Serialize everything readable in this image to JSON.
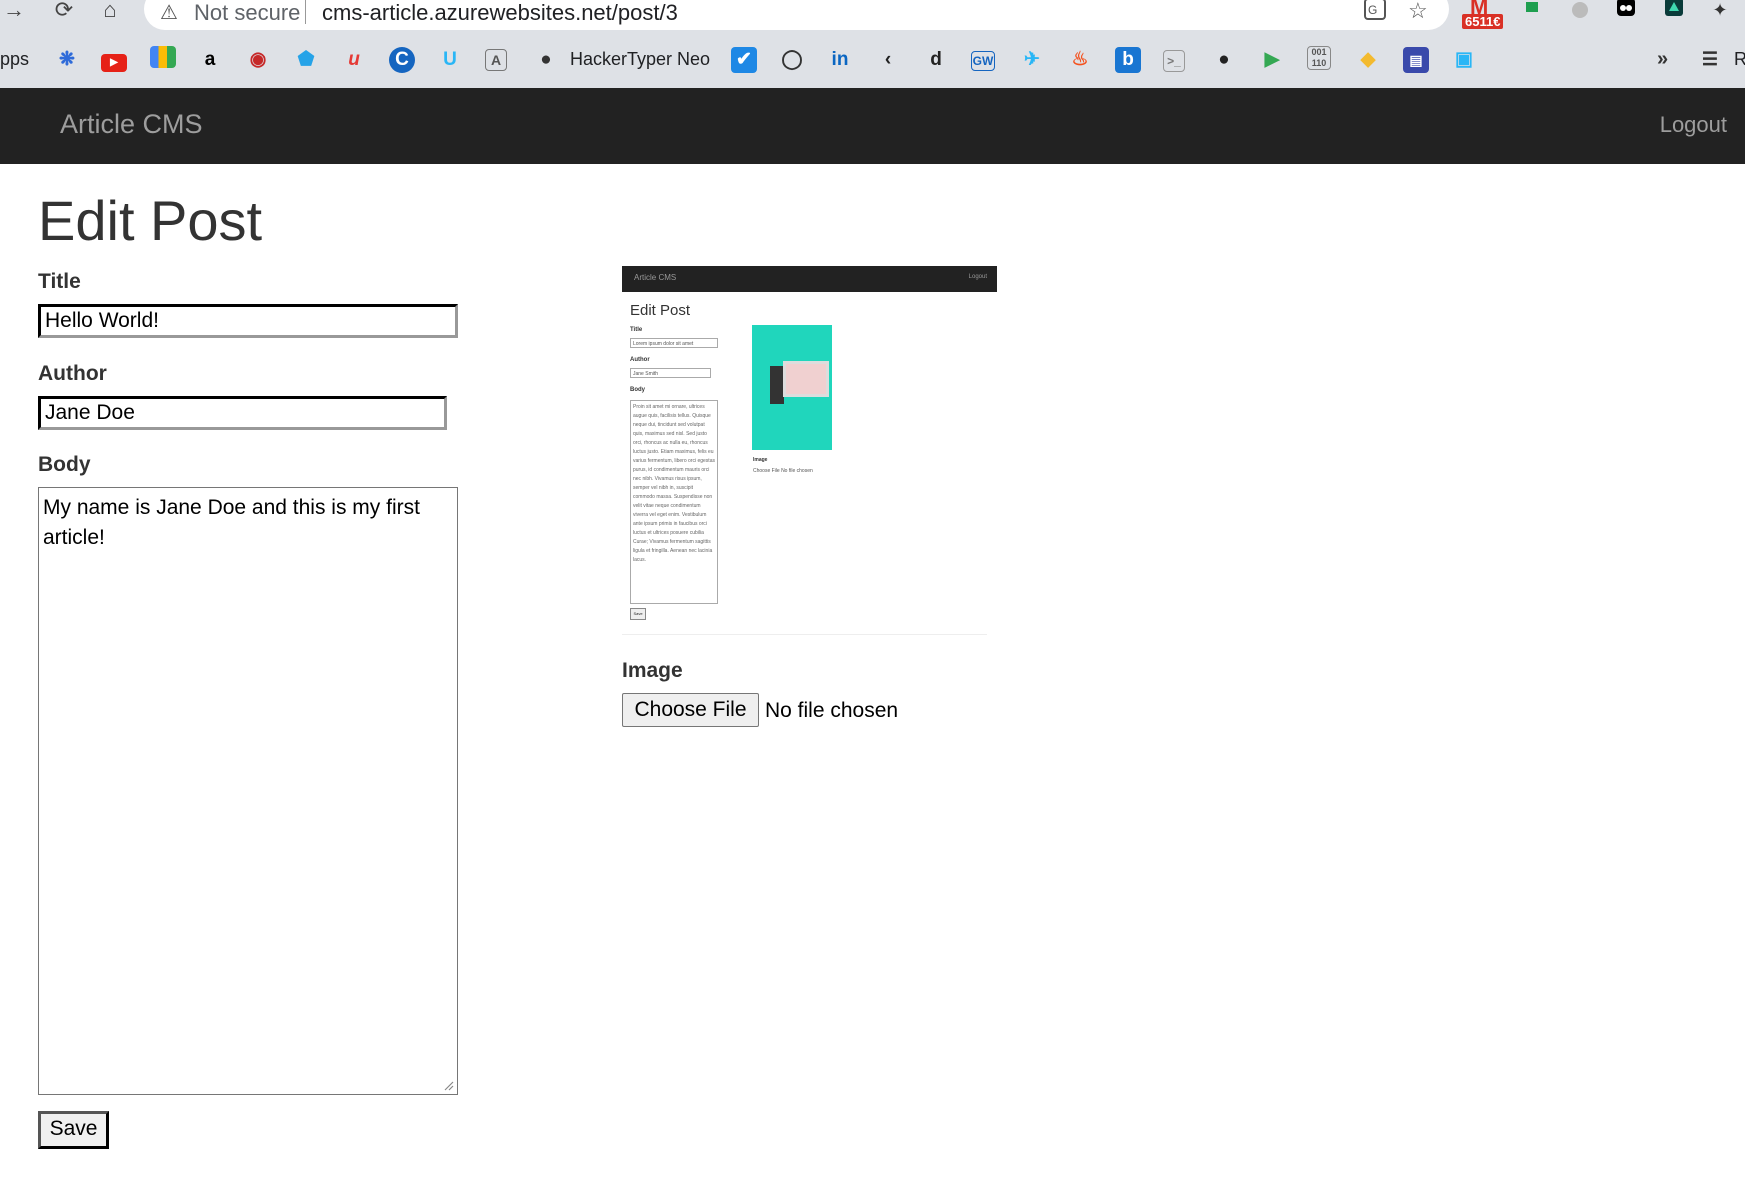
{
  "browser": {
    "nav": {
      "back_icon": "→",
      "reload_icon": "⟳",
      "home_icon": "⌂"
    },
    "omnibox": {
      "warning_icon": "⚠",
      "status": "Not secure",
      "url": "cms-article.azurewebsites.net/post/3"
    },
    "gmail_badge": {
      "letter": "M",
      "count": "6511€"
    },
    "bookmarks": {
      "apps_label": "pps",
      "hackertyper_label": "HackerTyper Neo",
      "more_label": "»",
      "reading_list_label": "R"
    }
  },
  "navbar": {
    "brand": "Article CMS",
    "logout": "Logout"
  },
  "page": {
    "title": "Edit Post"
  },
  "form": {
    "title_label": "Title",
    "title_value": "Hello World!",
    "author_label": "Author",
    "author_value": "Jane Doe",
    "body_label": "Body",
    "body_value": "My name is Jane Doe and this is my first article!",
    "save_label": "Save",
    "image_label": "Image",
    "choose_file_label": "Choose File",
    "file_status": "No file chosen"
  },
  "preview": {
    "brand": "Article CMS",
    "logout": "Logout",
    "title": "Edit Post",
    "title_label": "Title",
    "title_value": "Lorem ipsum dolor sit amet",
    "author_label": "Author",
    "author_value": "Jane Smith",
    "body_label": "Body",
    "body_value": "Proin sit amet mi ornare, ultrices augue quis, facilisis tellus. Quisque neque dui, tincidunt sed volutpat quis, maximus sed nisl. Sed justo orci, rhoncus ac nulla eu, rhoncus luctus justo. Etiam maximus, felis eu varius fermentum, libero orci egestas purus, id condimentum mauris orci nec nibh. Vivamus risus ipsum, semper vel nibh in, suscipit commodo massa. Suspendisse non velit vitae neque condimentum viverra vel eget enim. Vestibulum ante ipsum primis in faucibus orci luctus et ultrices posuere cubilia Curae; Vivamus fermentum sagittis ligula et fringilla. Aenean nec lacinia lacus.",
    "save_label": "Save",
    "image_label": "Image",
    "file_text": "Choose File  No file chosen"
  }
}
